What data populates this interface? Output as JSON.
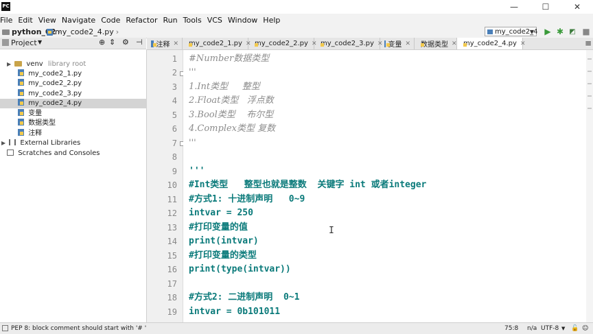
{
  "title_bar": {
    "app_badge": "PC",
    "minimize": "—",
    "maximize": "☐",
    "close": "✕"
  },
  "menu": [
    "File",
    "Edit",
    "View",
    "Navigate",
    "Code",
    "Refactor",
    "Run",
    "Tools",
    "VCS",
    "Window",
    "Help"
  ],
  "breadcrumb": {
    "project": "python_02",
    "file": "my_code2_4.py"
  },
  "run_config": {
    "selected": "my_code2_4"
  },
  "project_panel": {
    "title": "Project"
  },
  "tree": [
    {
      "label": "venv",
      "note": "library root"
    },
    {
      "label": "my_code2_1.py"
    },
    {
      "label": "my_code2_2.py"
    },
    {
      "label": "my_code2_3.py"
    },
    {
      "label": "my_code2_4.py"
    },
    {
      "label": "变量"
    },
    {
      "label": "数据类型"
    },
    {
      "label": "注释"
    },
    {
      "label": "External Libraries"
    },
    {
      "label": "Scratches and Consoles"
    }
  ],
  "tabs": [
    "注释",
    "my_code2_1.py",
    "my_code2_2.py",
    "my_code2_3.py",
    "变量",
    "数据类型",
    "my_code2_4.py"
  ],
  "active_tab": 6,
  "line_numbers": [
    "1",
    "2",
    "3",
    "4",
    "5",
    "6",
    "7",
    "8",
    "9",
    "10",
    "11",
    "12",
    "13",
    "14",
    "15",
    "16",
    "17",
    "18",
    "19"
  ],
  "code_lines": [
    "#Number数据类型",
    "'''",
    "1.Int类型     整型",
    "2.Float类型   浮点数",
    "3.Bool类型    布尔型",
    "4.Complex类型 复数",
    "'''",
    "",
    "'''",
    "#Int类型   整型也就是整数  关键字 int 或者integer",
    "#方式1: 十进制声明   0~9",
    "intvar = 250",
    "#打印变量的值",
    "print(intvar)",
    "#打印变量的类型",
    "print(type(intvar))",
    "",
    "#方式2: 二进制声明  0~1",
    "intvar = 0b101011"
  ],
  "status": {
    "message": "PEP 8: block comment should start with '# '",
    "position": "75:8",
    "line_sep": "n/a",
    "encoding": "UTF-8"
  },
  "colors": {
    "comment": "#8c8c8c",
    "docstring": "#0a7a7a",
    "selection": "#d4d4d4",
    "run": "#3a9a3a"
  }
}
